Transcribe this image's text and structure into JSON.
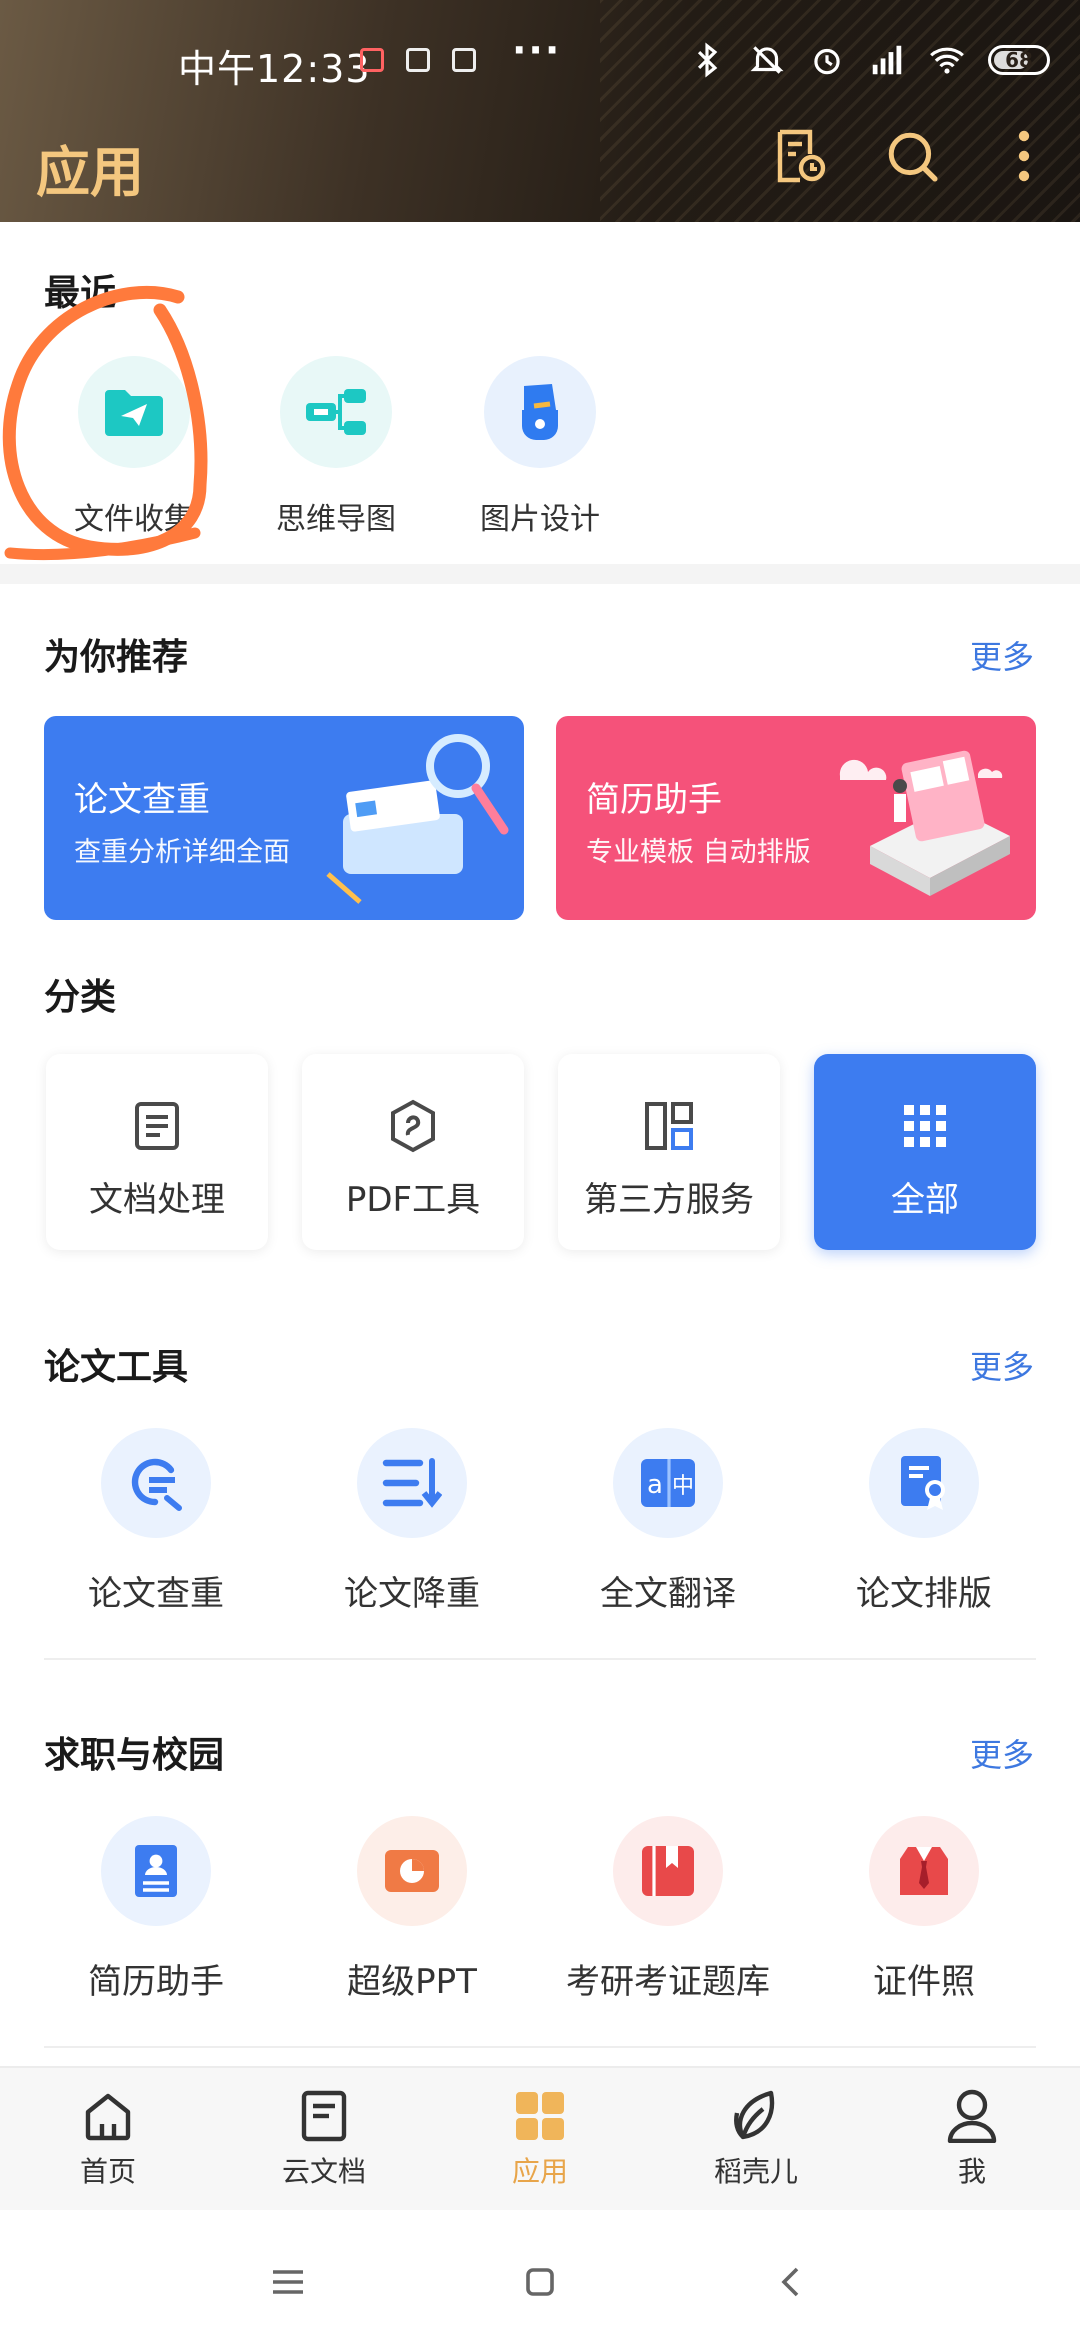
{
  "status_bar": {
    "time": "中午12:33",
    "more": "···",
    "battery": "68"
  },
  "app_bar": {
    "title": "应用"
  },
  "recent": {
    "title": "最近",
    "items": [
      {
        "label": "文件收集",
        "icon": "folder-send-icon"
      },
      {
        "label": "思维导图",
        "icon": "mindmap-icon"
      },
      {
        "label": "图片设计",
        "icon": "image-design-icon"
      }
    ]
  },
  "recommend": {
    "title": "为你推荐",
    "more": "更多",
    "banners": [
      {
        "title": "论文查重",
        "subtitle": "查重分析详细全面",
        "color": "#3d7cf0"
      },
      {
        "title": "简历助手",
        "subtitle": "专业模板 自动排版",
        "color": "#f5527a"
      }
    ]
  },
  "categories": {
    "title": "分类",
    "items": [
      {
        "label": "文档处理",
        "icon": "document-icon"
      },
      {
        "label": "PDF工具",
        "icon": "pdf-icon"
      },
      {
        "label": "第三方服务",
        "icon": "layout-icon"
      },
      {
        "label": "全部",
        "icon": "grid-icon",
        "active": true
      }
    ]
  },
  "paper_tools": {
    "title": "论文工具",
    "more": "更多",
    "items": [
      {
        "label": "论文查重",
        "icon": "search-check-icon"
      },
      {
        "label": "论文降重",
        "icon": "list-reduce-icon"
      },
      {
        "label": "全文翻译",
        "icon": "translate-icon"
      },
      {
        "label": "论文排版",
        "icon": "certificate-icon"
      }
    ]
  },
  "career": {
    "title": "求职与校园",
    "more": "更多",
    "items": [
      {
        "label": "简历助手",
        "icon": "resume-icon"
      },
      {
        "label": "超级PPT",
        "icon": "ppt-icon"
      },
      {
        "label": "考研考证题库",
        "icon": "book-icon"
      },
      {
        "label": "证件照",
        "icon": "id-photo-icon"
      }
    ]
  },
  "bottom_nav": {
    "items": [
      {
        "label": "首页",
        "icon": "home-icon"
      },
      {
        "label": "云文档",
        "icon": "cloud-doc-icon"
      },
      {
        "label": "应用",
        "icon": "apps-icon",
        "active": true
      },
      {
        "label": "稻壳儿",
        "icon": "leaf-icon"
      },
      {
        "label": "我",
        "icon": "profile-icon"
      }
    ]
  },
  "colors": {
    "accent_gold": "#f4c77f",
    "primary_blue": "#3d7cf0",
    "nav_active": "#e8a54a",
    "annotation": "#ff7a3c"
  }
}
